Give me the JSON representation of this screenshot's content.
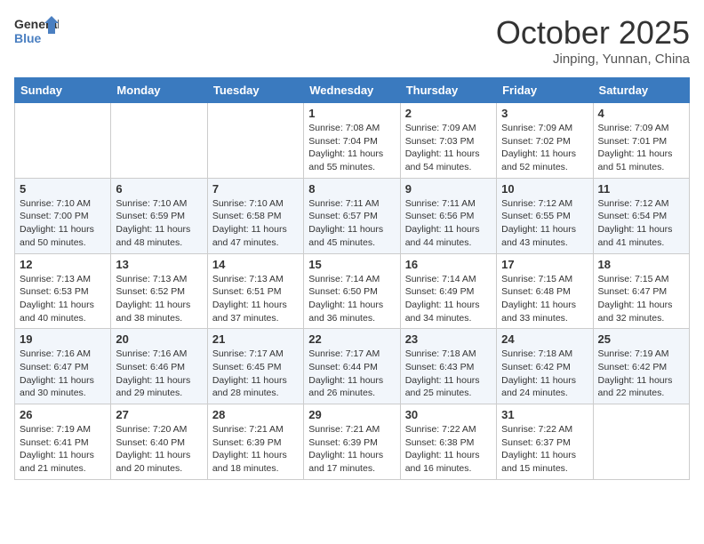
{
  "logo": {
    "text_general": "General",
    "text_blue": "Blue"
  },
  "title": "October 2025",
  "location": "Jinping, Yunnan, China",
  "days_header": [
    "Sunday",
    "Monday",
    "Tuesday",
    "Wednesday",
    "Thursday",
    "Friday",
    "Saturday"
  ],
  "weeks": [
    [
      {
        "day": "",
        "info": ""
      },
      {
        "day": "",
        "info": ""
      },
      {
        "day": "",
        "info": ""
      },
      {
        "day": "1",
        "info": "Sunrise: 7:08 AM\nSunset: 7:04 PM\nDaylight: 11 hours\nand 55 minutes."
      },
      {
        "day": "2",
        "info": "Sunrise: 7:09 AM\nSunset: 7:03 PM\nDaylight: 11 hours\nand 54 minutes."
      },
      {
        "day": "3",
        "info": "Sunrise: 7:09 AM\nSunset: 7:02 PM\nDaylight: 11 hours\nand 52 minutes."
      },
      {
        "day": "4",
        "info": "Sunrise: 7:09 AM\nSunset: 7:01 PM\nDaylight: 11 hours\nand 51 minutes."
      }
    ],
    [
      {
        "day": "5",
        "info": "Sunrise: 7:10 AM\nSunset: 7:00 PM\nDaylight: 11 hours\nand 50 minutes."
      },
      {
        "day": "6",
        "info": "Sunrise: 7:10 AM\nSunset: 6:59 PM\nDaylight: 11 hours\nand 48 minutes."
      },
      {
        "day": "7",
        "info": "Sunrise: 7:10 AM\nSunset: 6:58 PM\nDaylight: 11 hours\nand 47 minutes."
      },
      {
        "day": "8",
        "info": "Sunrise: 7:11 AM\nSunset: 6:57 PM\nDaylight: 11 hours\nand 45 minutes."
      },
      {
        "day": "9",
        "info": "Sunrise: 7:11 AM\nSunset: 6:56 PM\nDaylight: 11 hours\nand 44 minutes."
      },
      {
        "day": "10",
        "info": "Sunrise: 7:12 AM\nSunset: 6:55 PM\nDaylight: 11 hours\nand 43 minutes."
      },
      {
        "day": "11",
        "info": "Sunrise: 7:12 AM\nSunset: 6:54 PM\nDaylight: 11 hours\nand 41 minutes."
      }
    ],
    [
      {
        "day": "12",
        "info": "Sunrise: 7:13 AM\nSunset: 6:53 PM\nDaylight: 11 hours\nand 40 minutes."
      },
      {
        "day": "13",
        "info": "Sunrise: 7:13 AM\nSunset: 6:52 PM\nDaylight: 11 hours\nand 38 minutes."
      },
      {
        "day": "14",
        "info": "Sunrise: 7:13 AM\nSunset: 6:51 PM\nDaylight: 11 hours\nand 37 minutes."
      },
      {
        "day": "15",
        "info": "Sunrise: 7:14 AM\nSunset: 6:50 PM\nDaylight: 11 hours\nand 36 minutes."
      },
      {
        "day": "16",
        "info": "Sunrise: 7:14 AM\nSunset: 6:49 PM\nDaylight: 11 hours\nand 34 minutes."
      },
      {
        "day": "17",
        "info": "Sunrise: 7:15 AM\nSunset: 6:48 PM\nDaylight: 11 hours\nand 33 minutes."
      },
      {
        "day": "18",
        "info": "Sunrise: 7:15 AM\nSunset: 6:47 PM\nDaylight: 11 hours\nand 32 minutes."
      }
    ],
    [
      {
        "day": "19",
        "info": "Sunrise: 7:16 AM\nSunset: 6:47 PM\nDaylight: 11 hours\nand 30 minutes."
      },
      {
        "day": "20",
        "info": "Sunrise: 7:16 AM\nSunset: 6:46 PM\nDaylight: 11 hours\nand 29 minutes."
      },
      {
        "day": "21",
        "info": "Sunrise: 7:17 AM\nSunset: 6:45 PM\nDaylight: 11 hours\nand 28 minutes."
      },
      {
        "day": "22",
        "info": "Sunrise: 7:17 AM\nSunset: 6:44 PM\nDaylight: 11 hours\nand 26 minutes."
      },
      {
        "day": "23",
        "info": "Sunrise: 7:18 AM\nSunset: 6:43 PM\nDaylight: 11 hours\nand 25 minutes."
      },
      {
        "day": "24",
        "info": "Sunrise: 7:18 AM\nSunset: 6:42 PM\nDaylight: 11 hours\nand 24 minutes."
      },
      {
        "day": "25",
        "info": "Sunrise: 7:19 AM\nSunset: 6:42 PM\nDaylight: 11 hours\nand 22 minutes."
      }
    ],
    [
      {
        "day": "26",
        "info": "Sunrise: 7:19 AM\nSunset: 6:41 PM\nDaylight: 11 hours\nand 21 minutes."
      },
      {
        "day": "27",
        "info": "Sunrise: 7:20 AM\nSunset: 6:40 PM\nDaylight: 11 hours\nand 20 minutes."
      },
      {
        "day": "28",
        "info": "Sunrise: 7:21 AM\nSunset: 6:39 PM\nDaylight: 11 hours\nand 18 minutes."
      },
      {
        "day": "29",
        "info": "Sunrise: 7:21 AM\nSunset: 6:39 PM\nDaylight: 11 hours\nand 17 minutes."
      },
      {
        "day": "30",
        "info": "Sunrise: 7:22 AM\nSunset: 6:38 PM\nDaylight: 11 hours\nand 16 minutes."
      },
      {
        "day": "31",
        "info": "Sunrise: 7:22 AM\nSunset: 6:37 PM\nDaylight: 11 hours\nand 15 minutes."
      },
      {
        "day": "",
        "info": ""
      }
    ]
  ]
}
